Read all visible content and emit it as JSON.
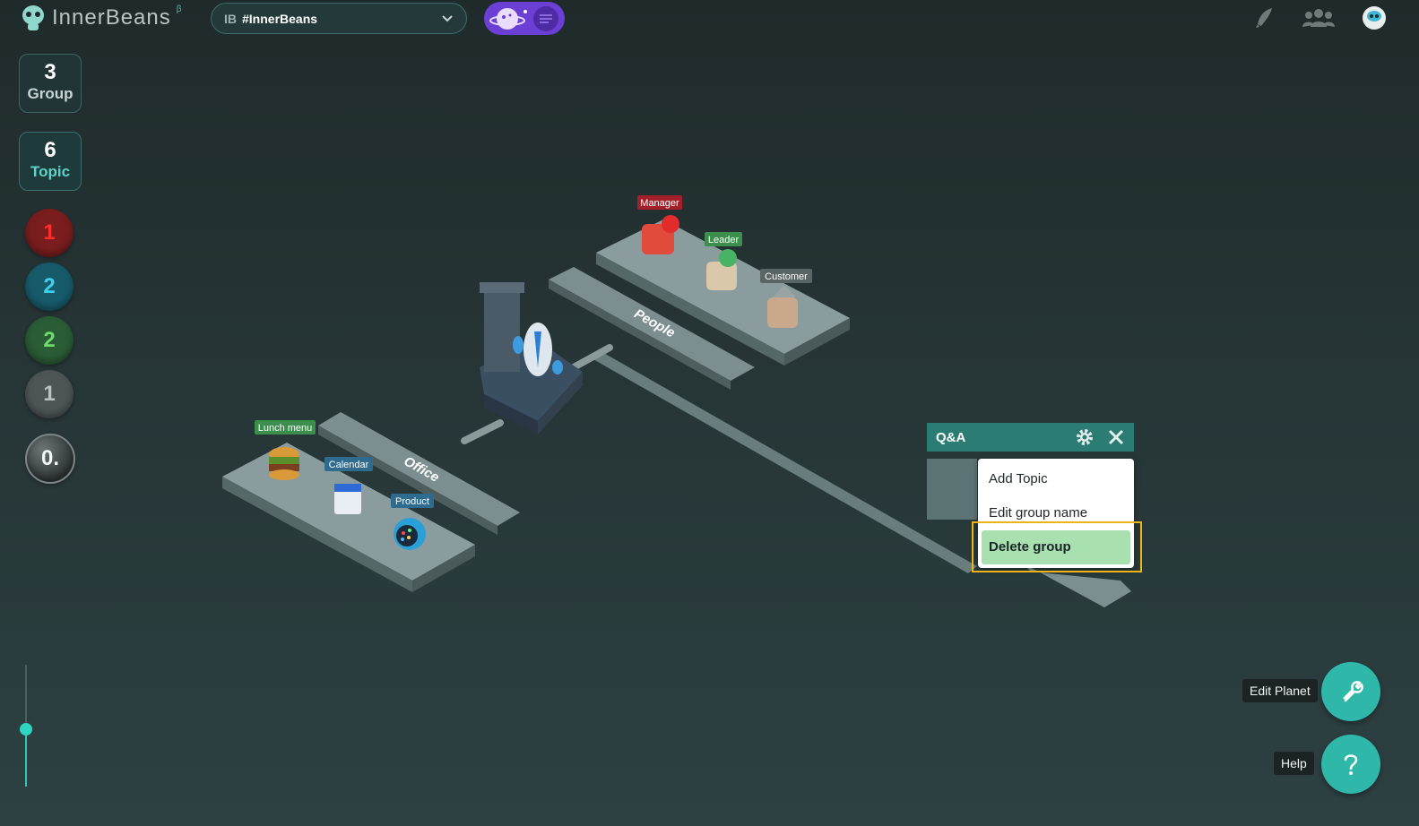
{
  "app": {
    "logo_text": "InnerBeans",
    "beta_mark": "β",
    "team_prefix": "IB",
    "team_name": "#InnerBeans"
  },
  "stats": {
    "group_count": "3",
    "group_label": "Group",
    "topic_count": "6",
    "topic_label": "Topic"
  },
  "status_dots": [
    {
      "value": "1",
      "color": "#ff2c2c"
    },
    {
      "value": "2",
      "color": "#3ed0f0"
    },
    {
      "value": "2",
      "color": "#6fdb6c"
    },
    {
      "value": "1",
      "color": "#b9c3c3"
    },
    {
      "value": "0.",
      "color": "#f2f6f6"
    }
  ],
  "scene": {
    "groups": [
      {
        "name": "People",
        "topics": [
          "Manager",
          "Leader",
          "Customer"
        ]
      },
      {
        "name": "Office",
        "topics": [
          "Lunch menu",
          "Calendar",
          "Product"
        ]
      }
    ]
  },
  "qa_panel": {
    "title": "Q&A",
    "menu": [
      "Add Topic",
      "Edit group name",
      "Delete group"
    ]
  },
  "actions": {
    "edit_planet": "Edit Planet",
    "help": "Help"
  },
  "colors": {
    "accent": "#2fb7a9",
    "planet_toggle": "#6b3fd4",
    "highlight": "#f0b41b",
    "selected_item": "#a8e0b0"
  },
  "icons": [
    "robot-logo-icon",
    "chevron-down-icon",
    "planet-icon",
    "chat-icon",
    "rocket-icon",
    "team-icon",
    "avatar-icon",
    "gear-icon",
    "close-icon",
    "wrench-icon",
    "question-icon"
  ]
}
